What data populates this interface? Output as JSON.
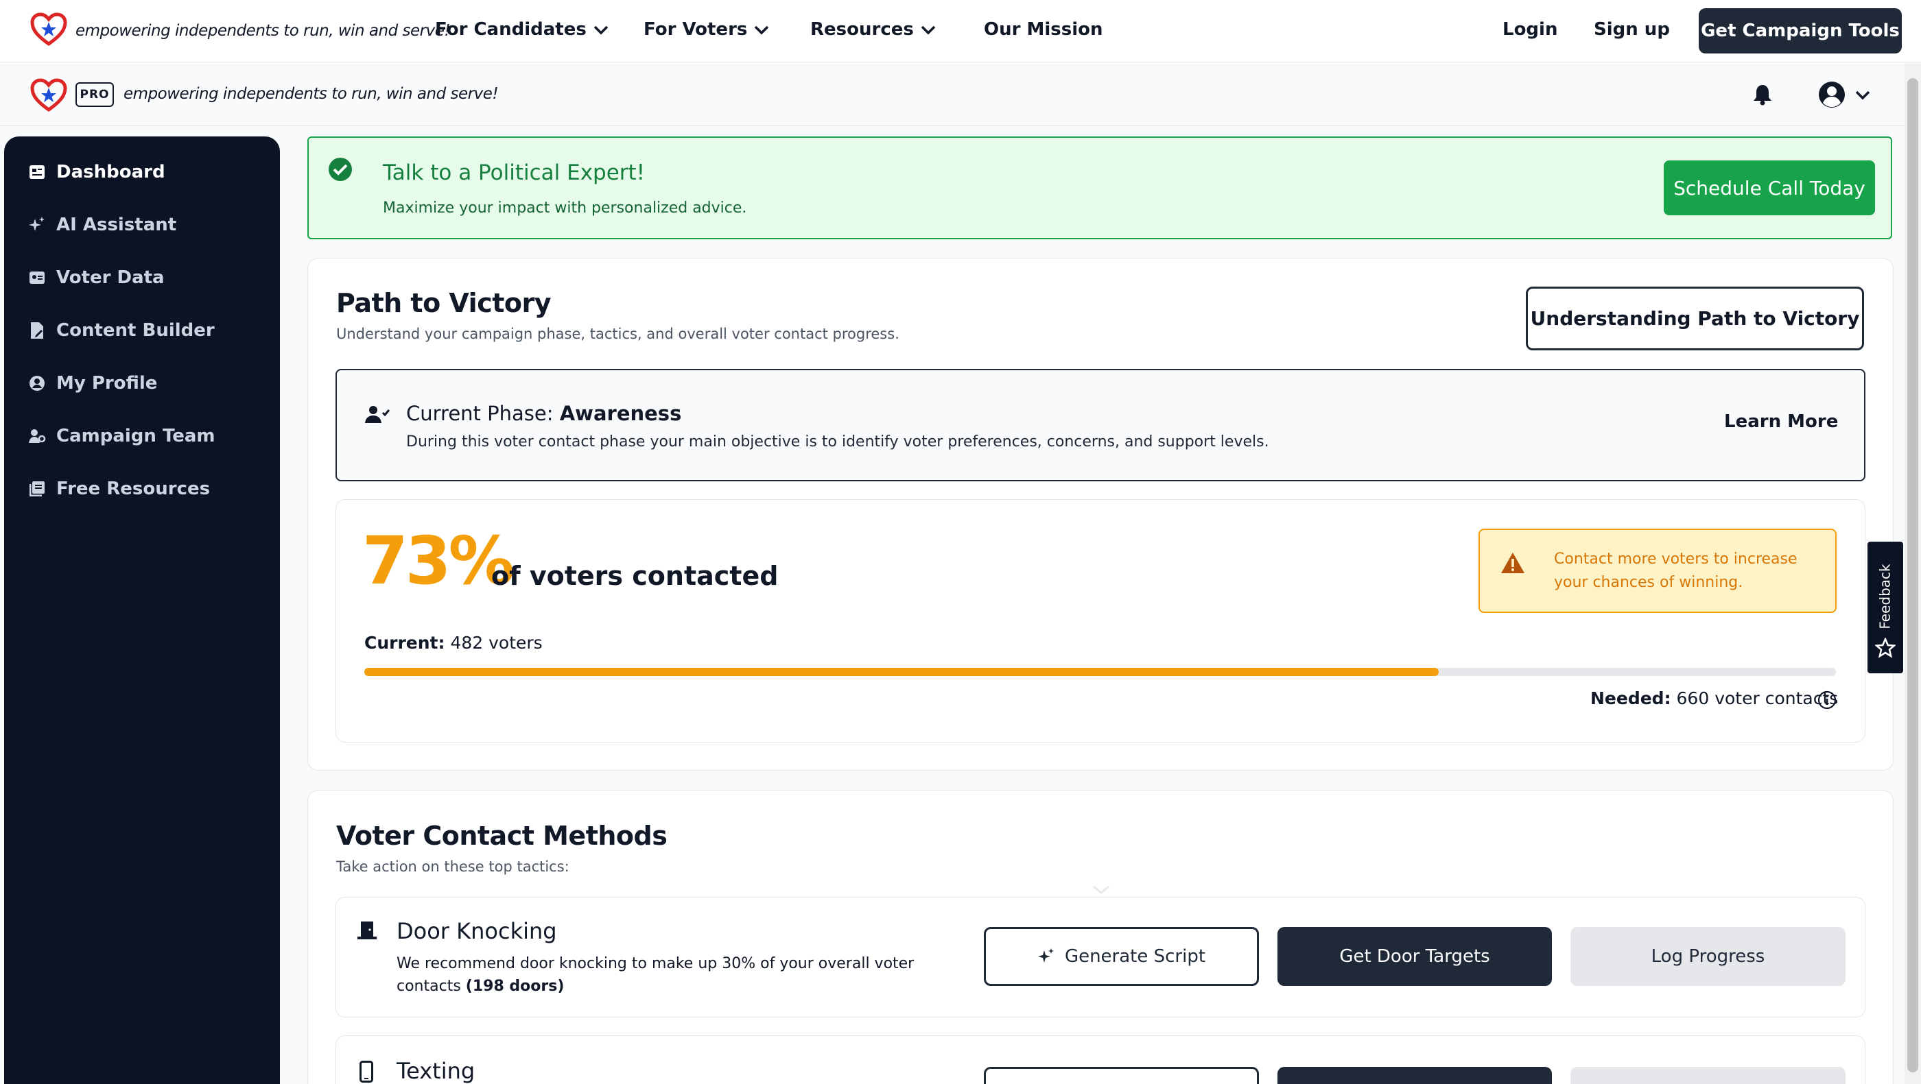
{
  "topnav": {
    "tagline": "empowering independents to run, win and serve!",
    "links": [
      "For Candidates",
      "For Voters",
      "Resources",
      "Our Mission"
    ],
    "login": "Login",
    "signup": "Sign up",
    "cta": "Get Campaign Tools"
  },
  "subnav": {
    "badge": "PRO",
    "tagline": "empowering independents to run, win and serve!"
  },
  "sidebar": {
    "items": [
      {
        "label": "Dashboard",
        "icon": "dashboard-icon",
        "active": true
      },
      {
        "label": "AI Assistant",
        "icon": "sparkles-icon"
      },
      {
        "label": "Voter Data",
        "icon": "id-card-icon"
      },
      {
        "label": "Content Builder",
        "icon": "file-pen-icon"
      },
      {
        "label": "My Profile",
        "icon": "user-circle-icon"
      },
      {
        "label": "Campaign Team",
        "icon": "team-icon"
      },
      {
        "label": "Free Resources",
        "icon": "book-icon"
      }
    ]
  },
  "alert": {
    "title": "Talk to a Political Expert!",
    "subtitle": "Maximize your impact with personalized advice.",
    "button": "Schedule Call Today"
  },
  "path": {
    "title": "Path to Victory",
    "subtitle": "Understand your campaign phase, tactics, and overall voter contact progress.",
    "button": "Understanding Path to Victory",
    "phase_label": "Current Phase:",
    "phase_value": "Awareness",
    "phase_desc": "During this voter contact phase your main objective is to identify voter preferences, concerns, and support levels.",
    "learn_more": "Learn More",
    "percent": "73%",
    "percent_label": "of voters contacted",
    "progress_fraction": 0.73,
    "current_label": "Current:",
    "current_value": "482 voters",
    "needed_label": "Needed:",
    "needed_value": "660 voter contacts",
    "warning": "Contact more voters to increase your chances of winning."
  },
  "methods": {
    "title": "Voter Contact Methods",
    "subtitle": "Take action on these top tactics:",
    "items": [
      {
        "name": "Door Knocking",
        "desc_pre": "We recommend door knocking to make up 30% of your overall voter contacts ",
        "desc_bold": "(198 doors)",
        "generate": "Generate Script",
        "targets": "Get Door Targets",
        "log": "Log Progress"
      },
      {
        "name": "Texting"
      }
    ]
  },
  "feedback": "Feedback",
  "colors": {
    "sidebar_bg": "#0b1324",
    "accent_green": "#16a34a",
    "accent_orange": "#f59e0b",
    "dark_button": "#1f2937"
  }
}
